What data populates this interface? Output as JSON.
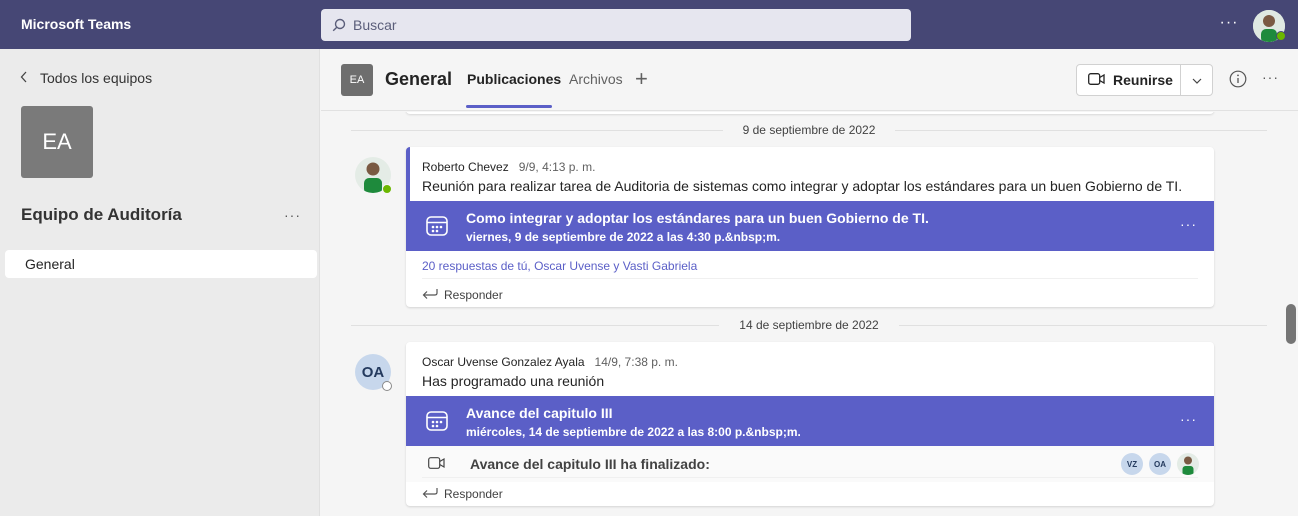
{
  "app": {
    "title": "Microsoft Teams"
  },
  "search": {
    "placeholder": "Buscar"
  },
  "sidebar": {
    "back_label": "Todos los equipos",
    "team_initials": "EA",
    "team_name": "Equipo de Auditoría",
    "channels": [
      {
        "label": "General"
      }
    ]
  },
  "channel": {
    "initials": "EA",
    "name": "General",
    "tabs": [
      {
        "label": "Publicaciones",
        "active": true
      },
      {
        "label": "Archivos",
        "active": false
      }
    ],
    "meet_label": "Reunirse"
  },
  "feed": {
    "dates": [
      "9 de septiembre de 2022",
      "14 de septiembre de 2022"
    ],
    "posts": [
      {
        "author": "Roberto Chevez",
        "time": "9/9, 4:13 p. m.",
        "body": "Reunión para realizar tarea de Auditoria de sistemas como integrar y adoptar los estándares para un buen Gobierno de TI.",
        "event_title": "Como integrar y adoptar los estándares para un buen Gobierno de TI.",
        "event_when": "viernes, 9 de septiembre de 2022 a las 4:30 p.&nbsp;m.",
        "replies": "20 respuestas de tú, Oscar Uvense y Vasti Gabriela",
        "reply_label": "Responder"
      },
      {
        "author": "Oscar Uvense Gonzalez Ayala",
        "author_initials": "OA",
        "time": "14/9, 7:38 p. m.",
        "body": "Has programado una reunión",
        "event_title": "Avance del capitulo III",
        "event_when": "miércoles, 14 de septiembre de 2022 a las 8:00 p.&nbsp;m.",
        "ended_text": "Avance del capitulo III ha finalizado:",
        "participants": [
          "VZ",
          "OA"
        ],
        "reply_label": "Responder"
      }
    ]
  },
  "colors": {
    "topbar": "#464775",
    "accent": "#5b5fc7",
    "available": "#6bb700"
  }
}
